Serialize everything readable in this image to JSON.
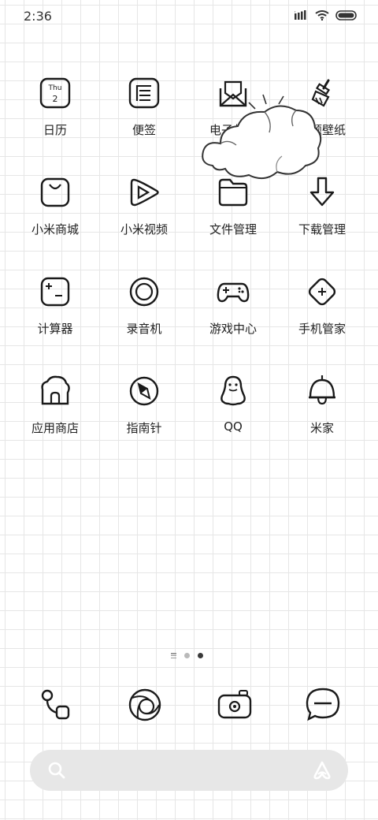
{
  "status_bar": {
    "time": "2:36",
    "icons": [
      "signal-icon",
      "wifi-icon",
      "battery-icon"
    ]
  },
  "apps": [
    {
      "name": "日历",
      "icon": "calendar-icon",
      "calendar_day": "Thu",
      "calendar_date": "2"
    },
    {
      "name": "便签",
      "icon": "notes-icon"
    },
    {
      "name": "电子邮件",
      "icon": "email-icon"
    },
    {
      "name": "主题壁纸",
      "icon": "themes-brush-icon"
    },
    {
      "name": "小米商城",
      "icon": "shopping-bag-icon"
    },
    {
      "name": "小米视频",
      "icon": "video-play-icon"
    },
    {
      "name": "文件管理",
      "icon": "folder-icon"
    },
    {
      "name": "下载管理",
      "icon": "download-arrow-icon"
    },
    {
      "name": "计算器",
      "icon": "calculator-icon"
    },
    {
      "name": "录音机",
      "icon": "recorder-icon"
    },
    {
      "name": "游戏中心",
      "icon": "gamepad-icon"
    },
    {
      "name": "手机管家",
      "icon": "security-plus-icon"
    },
    {
      "name": "应用商店",
      "icon": "app-store-house-icon"
    },
    {
      "name": "指南针",
      "icon": "compass-icon"
    },
    {
      "name": "QQ",
      "icon": "qq-penguin-icon"
    },
    {
      "name": "米家",
      "icon": "mijia-lamp-icon"
    }
  ],
  "weather_widget": {
    "icon": "cloud-icon"
  },
  "page_indicator": {
    "pages": 3,
    "current_page": 3
  },
  "dock": [
    {
      "icon": "phone-icon"
    },
    {
      "icon": "browser-icon"
    },
    {
      "icon": "camera-icon"
    },
    {
      "icon": "messages-icon"
    }
  ],
  "search_bar": {
    "icon": "search-icon",
    "assistant_icon": "assistant-icon"
  },
  "colors": {
    "ink": "#1a1a1a",
    "grid": "#e6e6e6",
    "search_bg": "#e7e7e7"
  }
}
